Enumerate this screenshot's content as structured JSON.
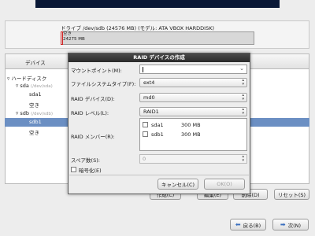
{
  "drive": {
    "title": "ドライブ /dev/sdb (24576 MB) (モデル: ATA VBOX HARDDISK)",
    "free_label": "空き",
    "free_size": "24275 MB"
  },
  "tree": {
    "column_device": "デバイス",
    "items": [
      {
        "label": "ハードディスク"
      },
      {
        "label": "sda",
        "sub": "(/dev/sda)"
      },
      {
        "label": "sda1"
      },
      {
        "label": "空き"
      },
      {
        "label": "sdb",
        "sub": "(/dev/sdb)"
      },
      {
        "label": "sdb1"
      },
      {
        "label": "空き"
      }
    ]
  },
  "dialog": {
    "title": "RAID デバイスの作成",
    "mount_label": "マウントポイント(M):",
    "mount_value": "",
    "fs_label": "ファイルシステムタイプ(F):",
    "fs_value": "ext4",
    "device_label": "RAID デバイス(D):",
    "device_value": "md0",
    "level_label": "RAID レベル(L):",
    "level_value": "RAID1",
    "members_label": "RAID メンバー(R):",
    "members": [
      {
        "name": "sda1",
        "size": "300 MB",
        "checked": false
      },
      {
        "name": "sdb1",
        "size": "300 MB",
        "checked": false
      }
    ],
    "spare_label": "スペア数(S):",
    "spare_value": "0",
    "encrypt_label": "暗号化(E)",
    "cancel": "キャンセル(C)",
    "ok": "OK(O)"
  },
  "bottom": {
    "create": "作成(C)",
    "edit": "編集(E)",
    "delete": "削除(D)",
    "reset": "リセット(S)",
    "back": "戻る(B)",
    "next": "次(N)"
  }
}
